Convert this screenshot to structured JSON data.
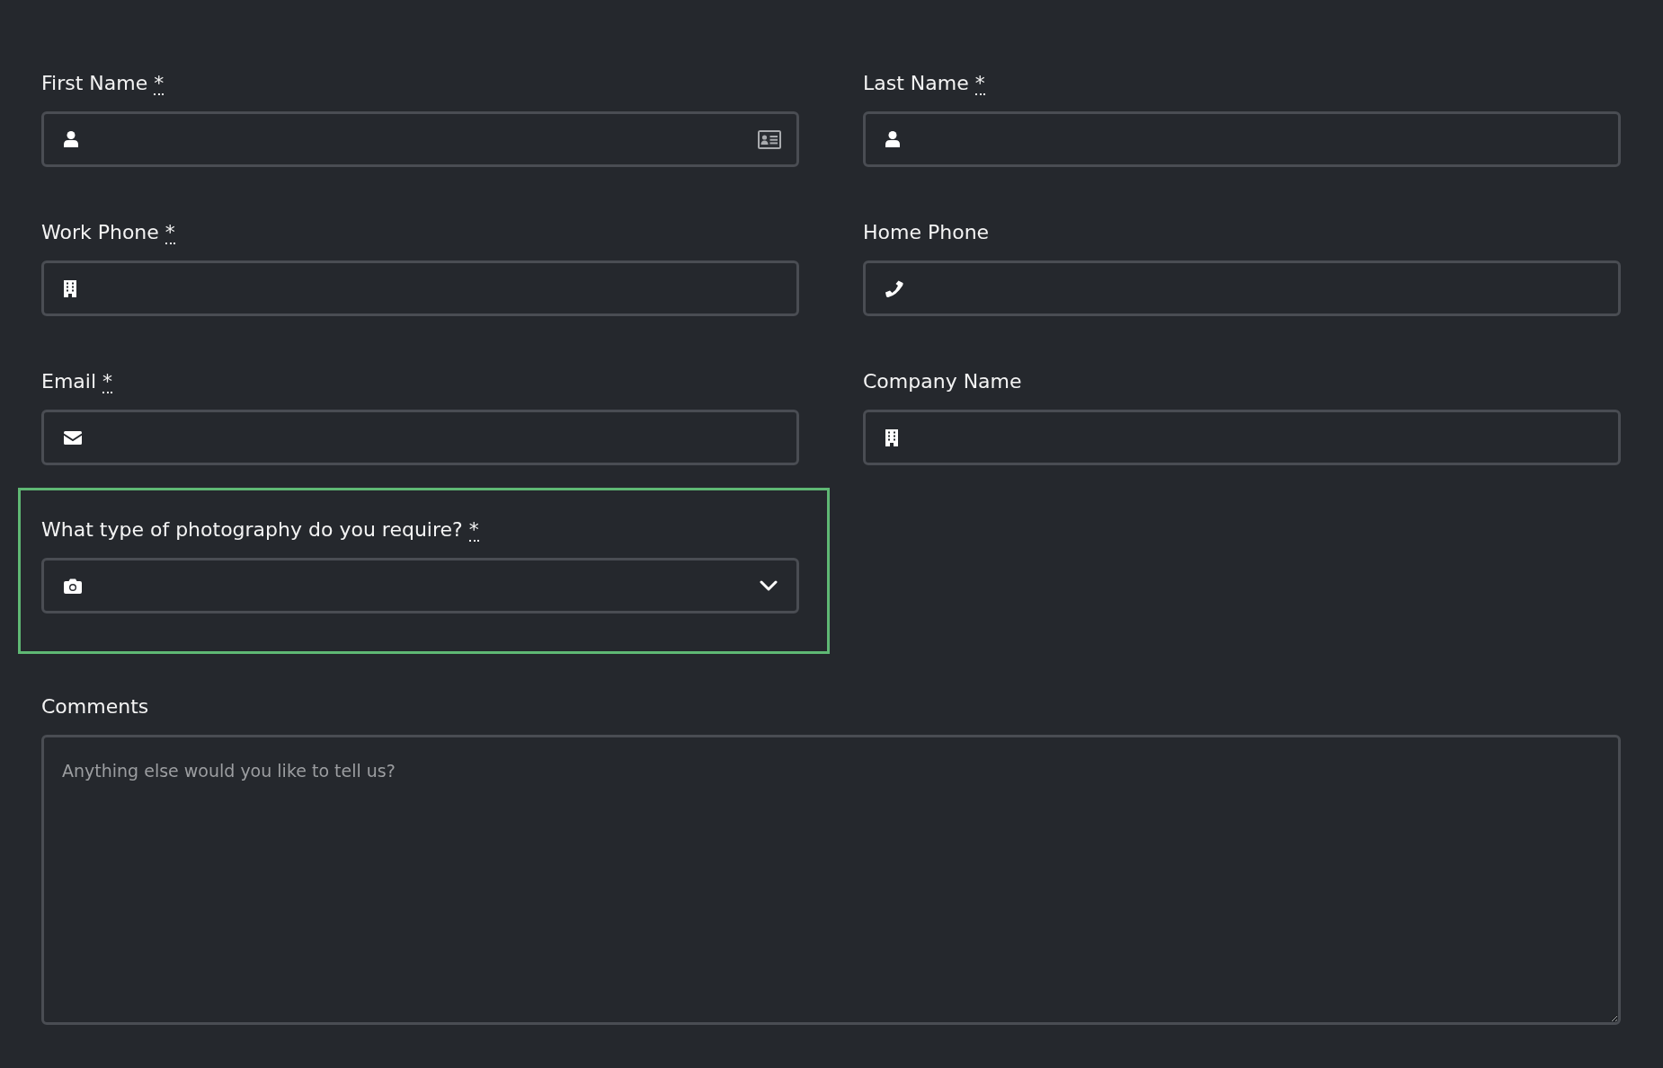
{
  "fields": [
    {
      "kind": "text",
      "label": "First Name",
      "required_mark": "*",
      "selected": false
    },
    {
      "kind": "text",
      "label": "Last Name",
      "required_mark": "*",
      "selected": false
    },
    {
      "kind": "text",
      "label": "Work Phone",
      "required_mark": "*",
      "selected": false
    },
    {
      "kind": "text",
      "label": "Home Phone",
      "selected": false
    },
    {
      "kind": "text",
      "label": "Email",
      "required_mark": "*",
      "selected": false
    },
    {
      "kind": "text",
      "label": "Company Name",
      "selected": false
    },
    {
      "kind": "select",
      "label": "What type of photography do you require?",
      "required_mark": "*",
      "selected": true
    },
    {
      "kind": "textarea",
      "label": "Comments",
      "placeholder": "Anything else would you like to tell us?",
      "selected": false
    }
  ]
}
